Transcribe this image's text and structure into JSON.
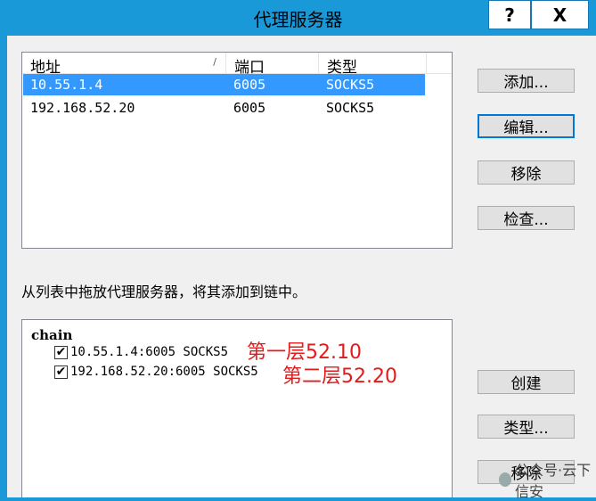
{
  "window": {
    "title": "代理服务器",
    "help_label": "?",
    "close_label": "X"
  },
  "proxy_list": {
    "columns": [
      "地址",
      "端口",
      "类型"
    ],
    "sort_indicator": "/",
    "rows": [
      {
        "address": "10.55.1.4",
        "port": "6005",
        "type": "SOCKS5",
        "selected": true
      },
      {
        "address": "192.168.52.20",
        "port": "6005",
        "type": "SOCKS5",
        "selected": false
      }
    ]
  },
  "buttons": {
    "add": "添加...",
    "edit": "编辑...",
    "remove": "移除",
    "check": "检查...",
    "create": "创建",
    "type": "类型...",
    "remove2": "移除"
  },
  "hint_text": "从列表中拖放代理服务器，将其添加到链中。",
  "chain": {
    "root_label": "chain",
    "items": [
      {
        "label": "10.55.1.4:6005 SOCKS5",
        "checked": true,
        "note": "第一层52.10"
      },
      {
        "label": "192.168.52.20:6005 SOCKS5",
        "checked": true,
        "note": "第二层52.20"
      }
    ]
  },
  "watermark": "公众号·云下信安",
  "colors": {
    "titlebar": "#1a99d8",
    "selection": "#3399ff",
    "annotation": "#e31b1b"
  }
}
